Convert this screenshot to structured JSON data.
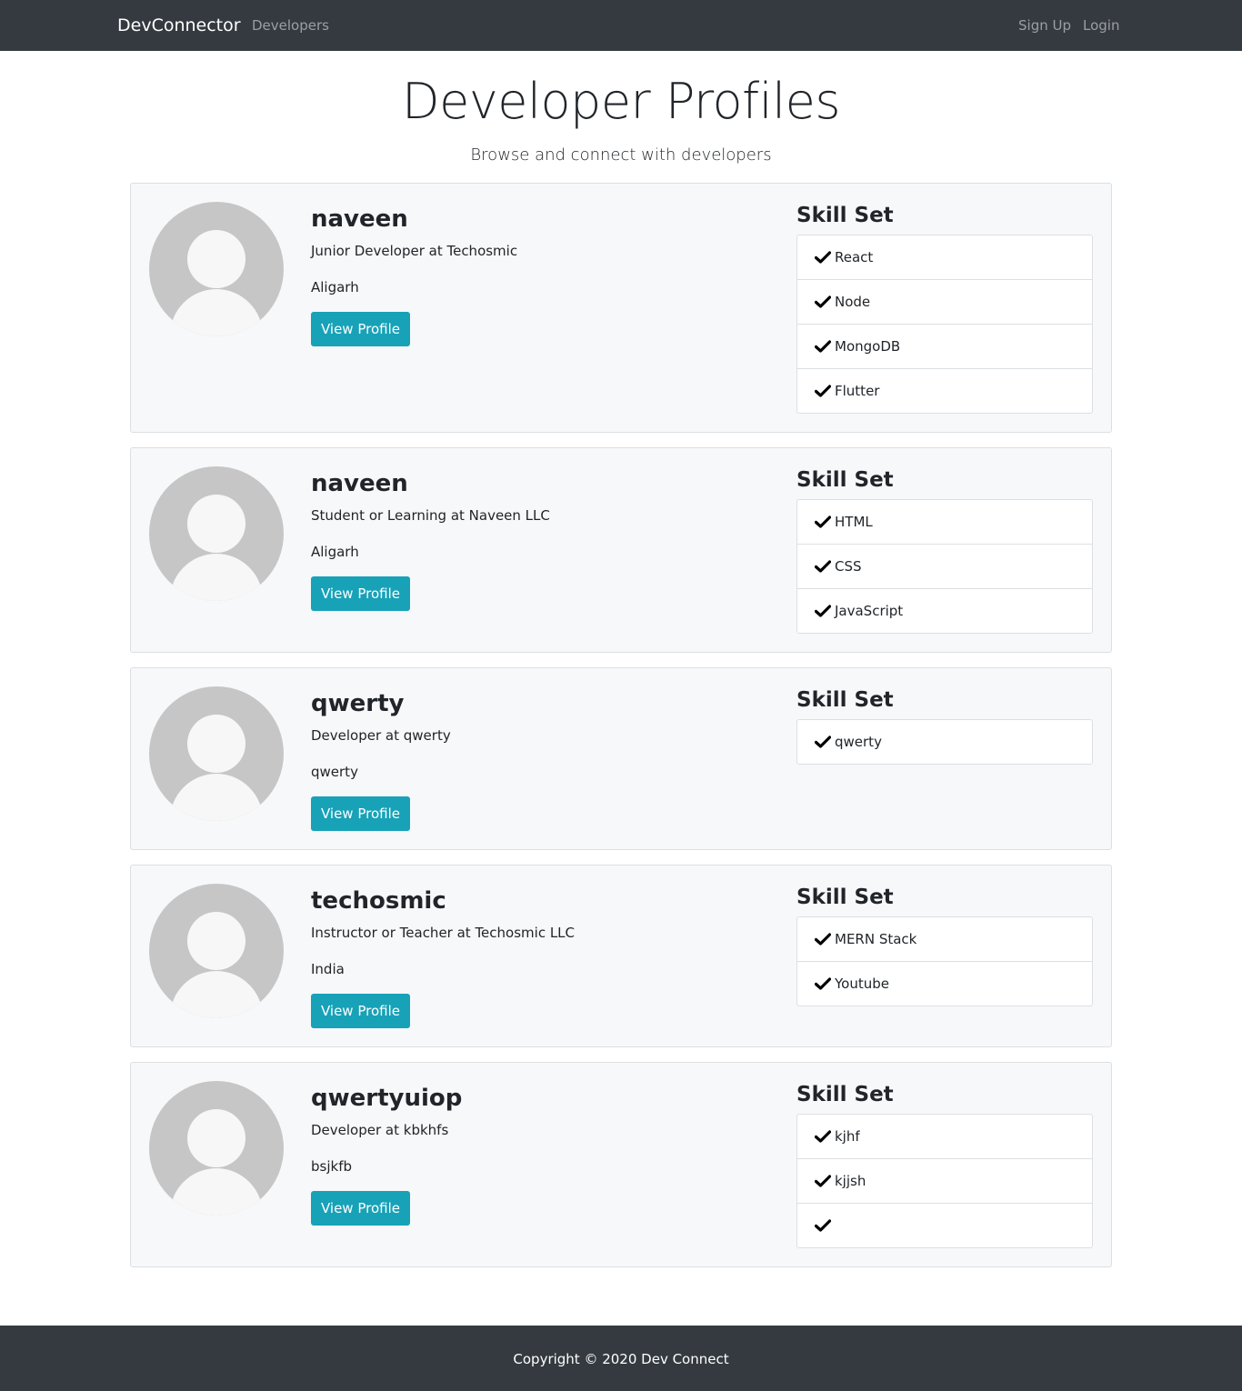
{
  "nav": {
    "brand": "DevConnector",
    "developers": "Developers",
    "signup": "Sign Up",
    "login": "Login"
  },
  "header": {
    "title": "Developer Profiles",
    "subtitle": "Browse and connect with developers"
  },
  "profiles": [
    {
      "name": "naveen",
      "status": "Junior Developer at Techosmic",
      "location": "Aligarh",
      "button": "View Profile",
      "skill_title": "Skill Set",
      "skills": [
        "React",
        "Node",
        "MongoDB",
        "Flutter"
      ]
    },
    {
      "name": "naveen",
      "status": "Student or Learning at Naveen LLC",
      "location": "Aligarh",
      "button": "View Profile",
      "skill_title": "Skill Set",
      "skills": [
        "HTML",
        "CSS",
        "JavaScript"
      ]
    },
    {
      "name": "qwerty",
      "status": "Developer at qwerty",
      "location": "qwerty",
      "button": "View Profile",
      "skill_title": "Skill Set",
      "skills": [
        "qwerty"
      ]
    },
    {
      "name": "techosmic",
      "status": "Instructor or Teacher at Techosmic LLC",
      "location": "India",
      "button": "View Profile",
      "skill_title": "Skill Set",
      "skills": [
        "MERN Stack",
        "Youtube"
      ]
    },
    {
      "name": "qwertyuiop",
      "status": "Developer at kbkhfs",
      "location": "bsjkfb",
      "button": "View Profile",
      "skill_title": "Skill Set",
      "skills": [
        "kjhf",
        "kjjsh",
        ""
      ]
    }
  ],
  "footer": {
    "text": "Copyright © 2020 Dev Connect"
  },
  "colors": {
    "navbar": "#343a40",
    "accent": "#17a2b8",
    "card_bg": "#f7f8fa",
    "avatar_bg": "#c6c6c6"
  },
  "icons": {
    "check": "check-icon",
    "avatar": "avatar-icon"
  }
}
